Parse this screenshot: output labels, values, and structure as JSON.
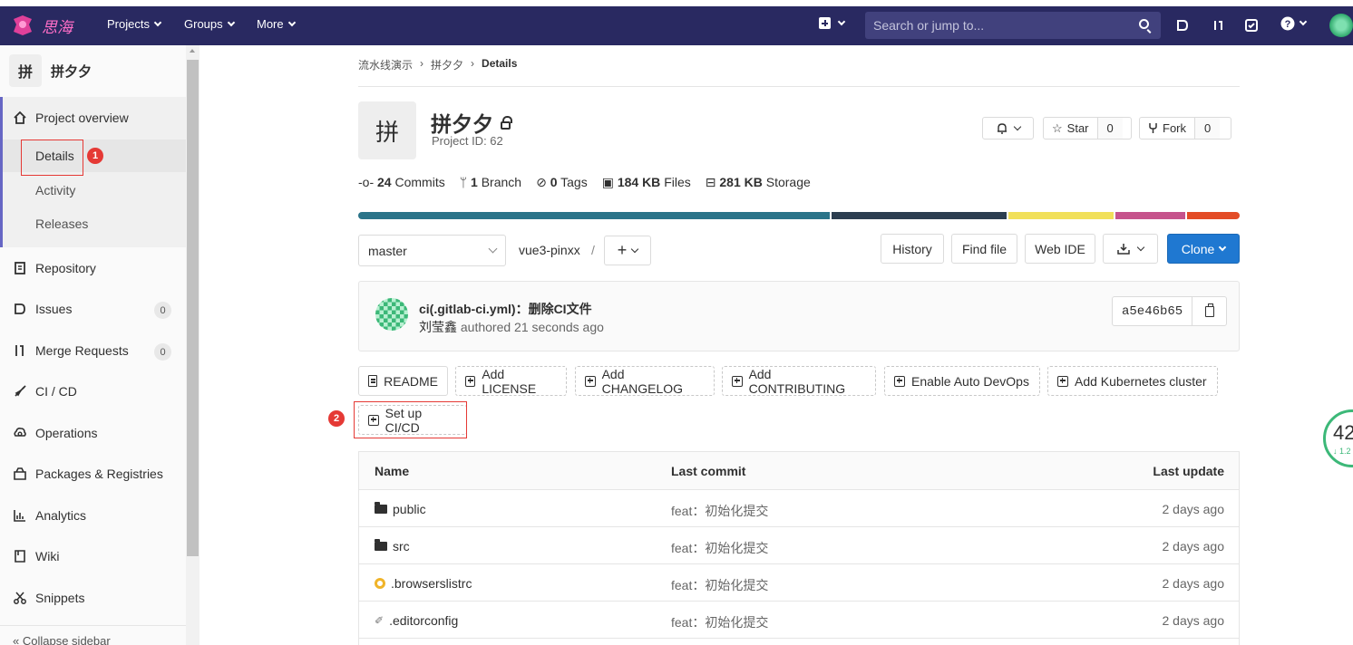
{
  "topnav": {
    "logo_text": "思海",
    "projects": "Projects",
    "groups": "Groups",
    "more": "More",
    "search_placeholder": "Search or jump to..."
  },
  "sidebar": {
    "project_avatar": "拼",
    "project_name": "拼夕夕",
    "overview": "Project overview",
    "details": "Details",
    "activity": "Activity",
    "releases": "Releases",
    "repository": "Repository",
    "issues": "Issues",
    "issues_count": "0",
    "merge_requests": "Merge Requests",
    "mr_count": "0",
    "cicd": "CI / CD",
    "operations": "Operations",
    "packages": "Packages & Registries",
    "analytics": "Analytics",
    "wiki": "Wiki",
    "snippets": "Snippets",
    "collapse": "Collapse sidebar"
  },
  "annotations": {
    "badge1": "1",
    "badge2": "2"
  },
  "breadcrumb": {
    "group": "流水线演示",
    "project": "拼夕夕",
    "current": "Details"
  },
  "project": {
    "avatar": "拼",
    "name": "拼夕夕",
    "id_text": "Project ID: 62",
    "star_label": "Star",
    "star_count": "0",
    "fork_label": "Fork",
    "fork_count": "0"
  },
  "stats": {
    "commits_num": "24",
    "commits_label": "Commits",
    "branch_num": "1",
    "branch_label": "Branch",
    "tags_num": "0",
    "tags_label": "Tags",
    "files_num": "184 KB",
    "files_label": "Files",
    "storage_num": "281 KB",
    "storage_label": "Storage"
  },
  "language_bar": [
    {
      "color": "#2b7489",
      "share": 0.54
    },
    {
      "color": "#2c3e50",
      "share": 0.2
    },
    {
      "color": "#f1e05a",
      "share": 0.12
    },
    {
      "color": "#c6538c",
      "share": 0.08
    },
    {
      "color": "#e34c26",
      "share": 0.06
    }
  ],
  "toolbar": {
    "branch": "master",
    "path": "vue3-pinxx",
    "slash": "/",
    "history": "History",
    "find_file": "Find file",
    "web_ide": "Web IDE",
    "clone": "Clone"
  },
  "last_commit": {
    "title": "ci(.gitlab-ci.yml)：删除CI文件",
    "author": "刘莹鑫",
    "authored": "authored 21 seconds ago",
    "sha": "a5e46b65"
  },
  "quick_actions": {
    "readme": "README",
    "license": "Add LICENSE",
    "changelog": "Add CHANGELOG",
    "contributing": "Add CONTRIBUTING",
    "autodevops": "Enable Auto DevOps",
    "kubernetes": "Add Kubernetes cluster",
    "setup_cicd": "Set up CI/CD"
  },
  "file_tree": {
    "headers": {
      "name": "Name",
      "commit": "Last commit",
      "update": "Last update"
    },
    "rows": [
      {
        "name": "public",
        "icon": "folder-icon",
        "commit": "feat：初始化提交",
        "update": "2 days ago"
      },
      {
        "name": "src",
        "icon": "folder-icon",
        "commit": "feat：初始化提交",
        "update": "2 days ago"
      },
      {
        "name": ".browserslistrc",
        "icon": "browserslist-icon",
        "commit": "feat：初始化提交",
        "update": "2 days ago"
      },
      {
        "name": ".editorconfig",
        "icon": "editorconfig-icon",
        "commit": "feat：初始化提交",
        "update": "2 days ago"
      }
    ]
  },
  "perf_widget": {
    "value": "42",
    "sub": "↓ 1.2"
  }
}
